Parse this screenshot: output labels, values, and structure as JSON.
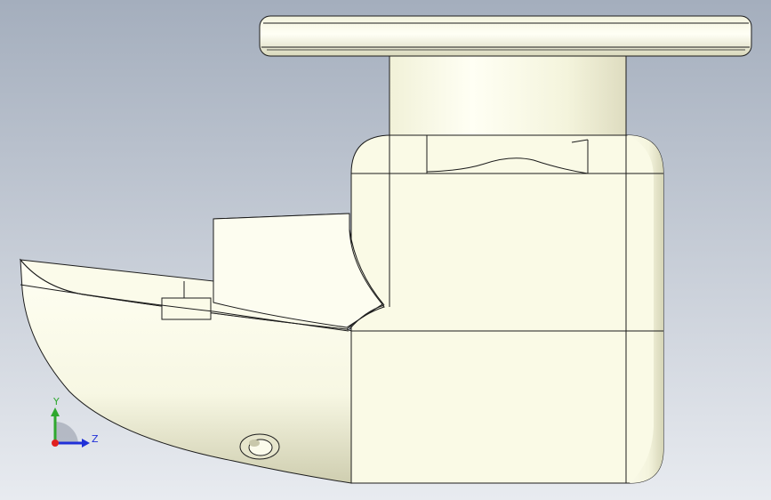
{
  "viewport": {
    "background_top": "#a7b1bf",
    "background_bottom": "#e7eaef",
    "model_fill": "#fafae8",
    "model_shade": "#d8d8b8",
    "edge_color": "#1c1c1c"
  },
  "triad": {
    "x_axis_color": "#e0201f",
    "y_axis_color": "#2ea82e",
    "z_axis_color": "#2030d8",
    "labels": {
      "y": "Y",
      "z": "Z"
    }
  }
}
